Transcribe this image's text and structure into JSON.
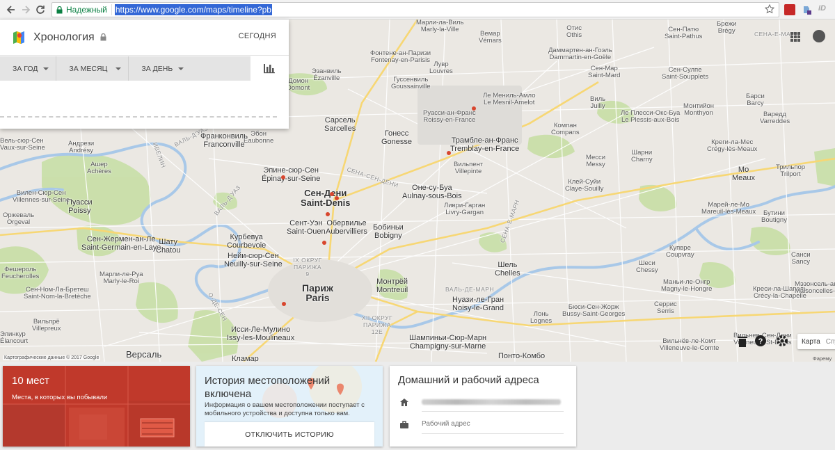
{
  "browser": {
    "secure_label": "Надежный",
    "url": "https://www.google.com/maps/timeline?pb"
  },
  "timeline": {
    "title": "Хронология",
    "today": "СЕГОДНЯ",
    "filters": [
      "ЗА ГОД",
      "ЗА МЕСЯЦ",
      "ЗА ДЕНЬ"
    ]
  },
  "map": {
    "copyright": "Картографические данные © 2017 Google",
    "map_type": "Карта",
    "satellite": "Спу",
    "corner_place": "Фарему",
    "area_labels": {
      "a1": "ВАЛЬ-Д'УАЗ",
      "a2": "ИВЕЛИН",
      "a3": "СЕНА-СЕН-ДЕНИ",
      "a4": "ВАЛЬ-Д'УАЗ",
      "a5": "СЕНА-Е-МАРН",
      "a6": "IX ОКРУГ ПАРИЖА 9",
      "a7": "XII ОКРУГ ПАРИЖА 12Е",
      "a8": "О-ДЕ-СЕН",
      "a9": "ВАЛЬ-ДЕ-МАРН",
      "a10": "СЕНА-Е-МАРН"
    },
    "places": {
      "p1": [
        "Марли-ла-Виль",
        "Marly-la-Ville"
      ],
      "p2": [
        "Фонтене-ан-Паризи",
        "Fontenay-en-Parisis"
      ],
      "p3": [
        "Вемар",
        "Vémars"
      ],
      "p4": [
        "Отис",
        "Othis"
      ],
      "p5": [
        "Сен-Патю",
        "Saint-Pathus"
      ],
      "p6": [
        "Даммартен-ан-Гоэль",
        "Dammartin-en-Goële"
      ],
      "p7": [
        "Брежи",
        "Brégy"
      ],
      "p8": [
        "Эзанвиль",
        "Ézanville"
      ],
      "p9": [
        "Лувр",
        "Louvres"
      ],
      "p10": [
        "Гуссенвиль",
        "Goussainville"
      ],
      "p11": [
        "Сен-Map",
        "Saint-Mard"
      ],
      "p12": [
        "Сен-Сулпе",
        "Saint-Soupplets"
      ],
      "p13": [
        "Ле Мениль-Амло",
        "Le Mesnil-Amelot"
      ],
      "p14": [
        "Виль",
        "Juilly"
      ],
      "p15": [
        "Монтийон",
        "Monthyon"
      ],
      "p16": [
        "Барси",
        "Barcy"
      ],
      "p17": [
        "Руасси-ан-Франс",
        "Roissy-en-France"
      ],
      "p18": [
        "Ле Плесси-Окс-Буа",
        "Le Plessis-aux-Bois"
      ],
      "p19": [
        "Варедд",
        "Varreddes"
      ],
      "p20": [
        "Сарсель",
        "Sarcelles"
      ],
      "p21": [
        "Гонесс",
        "Gonesse"
      ],
      "p22": [
        "Компан",
        "Compans"
      ],
      "p23": [
        "Трамбле-ан-Франс",
        "Tremblay-en-France"
      ],
      "p24": [
        "Вильпент",
        "Villepinte"
      ],
      "p25": [
        "Месси",
        "Messy"
      ],
      "p26": [
        "Шарни",
        "Charny"
      ],
      "p27": [
        "Креги-ла-Мес",
        "Crégy-lès-Meaux"
      ],
      "p28": [
        "Мо",
        "Meaux"
      ],
      "p29": [
        "Трильпор",
        "Trilport"
      ],
      "p30": [
        "Эпине-сюр-Сен",
        "Épinay-sur-Seine"
      ],
      "p31": [
        "Сен-Дени",
        "Saint-Denis"
      ],
      "p32": [
        "Оне-су-Буа",
        "Aulnay-sous-Bois"
      ],
      "p33": [
        "Клей-Суйи",
        "Claye-Souilly"
      ],
      "p34": [
        "Ливри-Гарган",
        "Livry-Gargan"
      ],
      "p35": [
        "Марей-ле-Мо",
        "Mareuil-lès-Meaux"
      ],
      "p36": [
        "Бутини",
        "Boutigny"
      ],
      "p37": [
        "Сент-Уэн",
        "Saint-Ouen"
      ],
      "p38": [
        "Обервилье",
        "Aubervilliers"
      ],
      "p39": [
        "Бобиньи",
        "Bobigny"
      ],
      "p40": [
        "Курбевуа",
        "Courbevoie"
      ],
      "p41": [
        "Нейи-сюр-Сен",
        "Neuilly-sur-Seine"
      ],
      "p42": [
        "Шель",
        "Chelles"
      ],
      "p43": [
        "Шеси",
        "Chessy"
      ],
      "p44": [
        "Купвре",
        "Coupvray"
      ],
      "p45": [
        "Санси",
        "Sancy"
      ],
      "p46": [
        "Монтрёй",
        "Montreuil"
      ],
      "p47": [
        "Маньи-ле-Онгр",
        "Magny-le-Hongre"
      ],
      "p48": [
        "Нуази-ле-Гран",
        "Noisy-le-Grand"
      ],
      "p49": [
        "Лонь",
        "Lognes"
      ],
      "p50": [
        "Бюси-Сен-Жорж",
        "Bussy-Saint-Georges"
      ],
      "p51": [
        "Серрис",
        "Serris"
      ],
      "p52": [
        "Креси-ла-Шапель",
        "Crécy-la-Chapelle"
      ],
      "p53": [
        "Мэзонсель-ан-Бри",
        "Maisoncelles-en-Brie"
      ],
      "p54": [
        "Исси-Ле-Мулино",
        "Issy-les-Moulineaux"
      ],
      "p55": [
        "Шампиньи-Сюр-Марн",
        "Champigny-sur-Marne"
      ],
      "p56": [
        "Вильнёв-ле-Комт",
        "Villeneuve-le-Comte"
      ],
      "p57": [
        "Вильнев-Сен-Дени",
        "Villeneuve-St-Denis"
      ],
      "p58": [
        "Понто-Комбо",
        ""
      ],
      "p59": [
        "Кламар",
        ""
      ],
      "p60": [
        "Версаль",
        ""
      ],
      "p61": [
        "Домон",
        "Domont"
      ],
      "p62": [
        "Эбон",
        "Eaubonne"
      ],
      "p63": [
        "Франконвиль",
        "Franconville"
      ],
      "p64": [
        "Андрези",
        "Andrésy"
      ],
      "p65": [
        "Ашер",
        "Achères"
      ],
      "p66": [
        "Вилен-Сюр-Сен",
        "Villennes-sur-Seine"
      ],
      "p67": [
        "Пуасси",
        "Poissy"
      ],
      "p68": [
        "Оржеваль",
        "Orgeval"
      ],
      "p69": [
        "Сен-Жермен-ан-Ле",
        "Saint-Germain-en-Laye"
      ],
      "p70": [
        "Шату",
        "Chatou"
      ],
      "p71": [
        "Марли-ле-Руа",
        "Marly-le-Roi"
      ],
      "p72": [
        "Сен-Ном-Ла-Бретеш",
        "Saint-Nom-la-Bretèche"
      ],
      "p73": [
        "Фешероль",
        "Feucherolles"
      ],
      "p74": [
        "Вильпрё",
        "Villepreux"
      ],
      "p75": [
        "Элинкур",
        "Élancourt"
      ],
      "p76": [
        "Вель-сюр-Сен",
        "Vaux-sur-Seine"
      ]
    },
    "city": [
      "Париж",
      "Paris"
    ]
  },
  "cards": {
    "places_count": "10 мест",
    "places_sub": "Места, в которых вы побывали",
    "history_title": "История местоположений включена",
    "history_desc": "Информация о вашем местоположении поступает с мобильного устройства и доступна только вам.",
    "history_button": "ОТКЛЮЧИТЬ ИСТОРИЮ",
    "home_title": "Домашний и рабочий адреса",
    "work_placeholder": "Рабочий адрес"
  },
  "colors": {
    "map_bg": "#ebe8e3",
    "park": "#c8dfa6",
    "water": "#a8c8e8",
    "road": "#ffffff",
    "highway": "#f7d774",
    "place_marker": "#d8462e",
    "places_card": "#c0392b",
    "history_card": "#e3f1fa"
  }
}
